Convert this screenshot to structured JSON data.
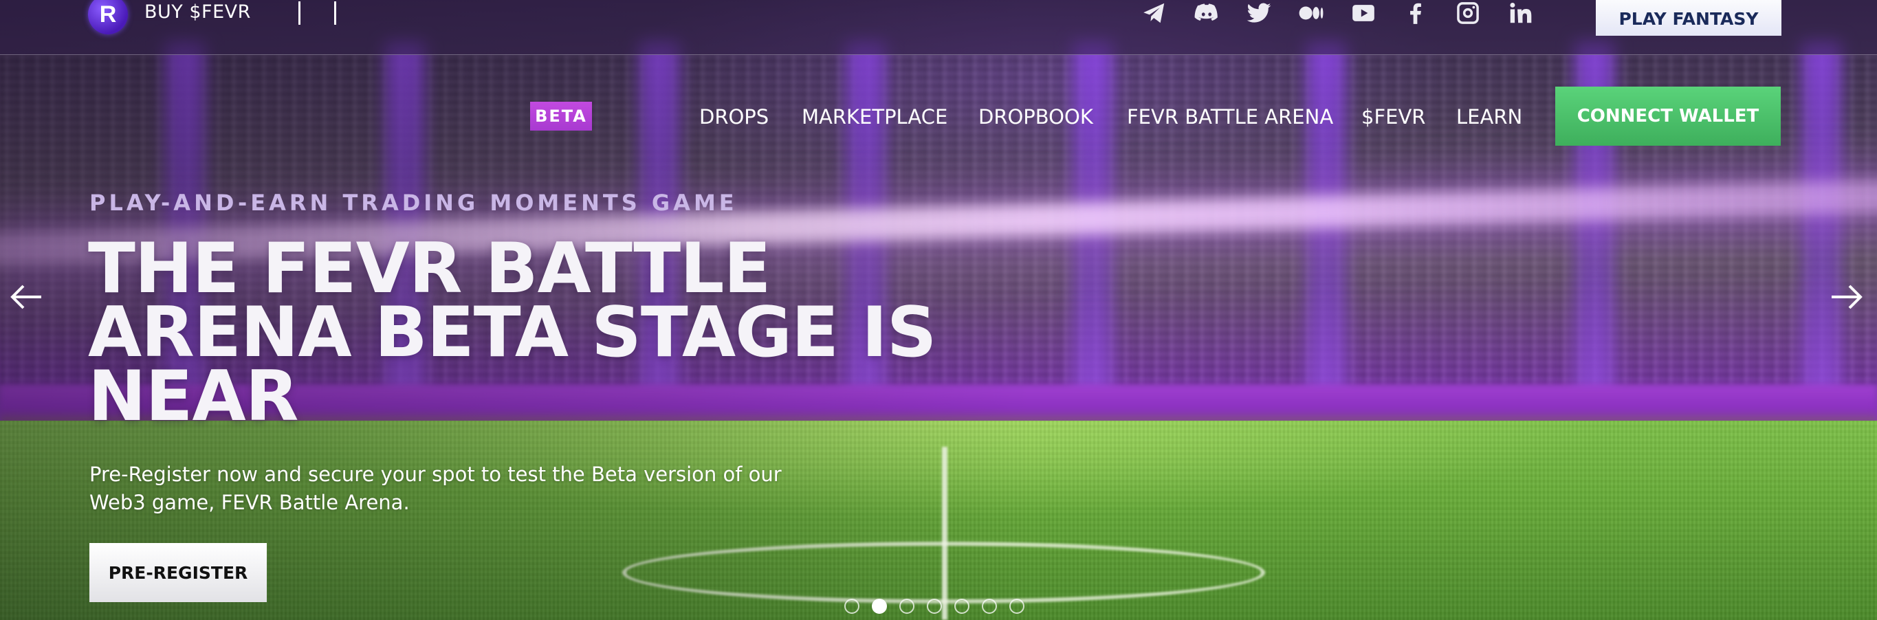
{
  "topbar": {
    "logo_text": "R",
    "buy_label": "BUY $FEVR",
    "social": [
      "telegram-icon",
      "discord-icon",
      "twitter-icon",
      "medium-icon",
      "youtube-icon",
      "facebook-icon",
      "instagram-icon",
      "linkedin-icon"
    ],
    "play_fantasy_label": "PLAY FANTASY"
  },
  "nav": {
    "beta_badge": "BETA",
    "items": [
      "DROPS",
      "MARKETPLACE",
      "DROPBOOK",
      "FEVR BATTLE ARENA",
      "$FEVR",
      "LEARN"
    ],
    "connect_label": "CONNECT WALLET"
  },
  "hero": {
    "kicker": "PLAY-AND-EARN TRADING MOMENTS GAME",
    "headline_lines": [
      "THE FEVR BATTLE",
      "ARENA BETA STAGE IS",
      "NEAR"
    ],
    "subtitle": "Pre-Register now and secure your spot to test the Beta version of our Web3 game, FEVR Battle Arena.",
    "cta_label": "PRE-REGISTER"
  },
  "carousel": {
    "slide_count": 7,
    "active_slide": 2
  },
  "colors": {
    "accent_purple": "#a83ad0",
    "connect_green": "#4cc26c",
    "kicker_lavender": "#c9b6e6",
    "fantasy_text": "#1a2a5a"
  }
}
